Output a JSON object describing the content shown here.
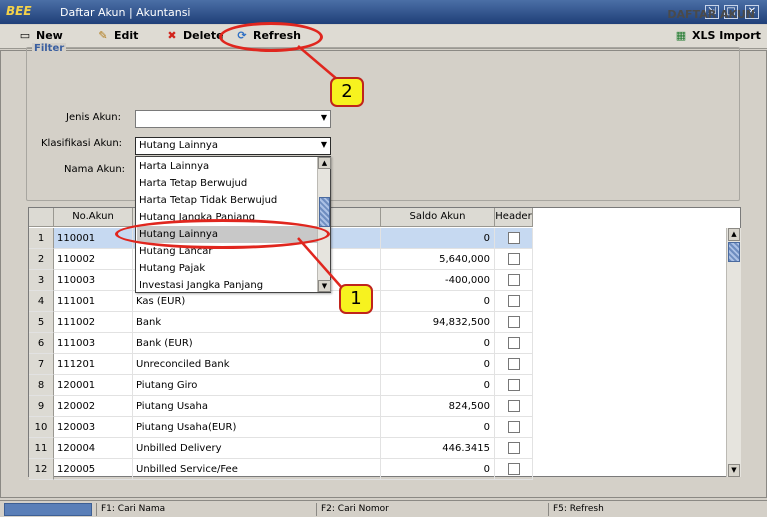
{
  "window": {
    "logo": "BEE",
    "title": "Daftar Akun | Akuntansi",
    "controls": [
      "restore-icon",
      "maximize-icon",
      "close-icon"
    ]
  },
  "toolbar": {
    "new_label": "New",
    "edit_label": "Edit",
    "delete_label": "Delete",
    "refresh_label": "Refresh",
    "xls_label": "XLS Import"
  },
  "section_title": "DAFTAR AKUN",
  "filter": {
    "legend": "Filter",
    "jenis_label": "Jenis Akun:",
    "jenis_value": "",
    "klasifikasi_label": "Klasifikasi Akun:",
    "klasifikasi_value": "Hutang Lainnya",
    "nama_label": "Nama Akun:",
    "dropdown_options": [
      "Harta Lainnya",
      "Harta Tetap Berwujud",
      "Harta Tetap Tidak Berwujud",
      "Hutang Jangka Panjang",
      "Hutang Lainnya",
      "Hutang Lancar",
      "Hutang Pajak",
      "Investasi Jangka Panjang"
    ],
    "dropdown_highlighted": "Hutang Lainnya"
  },
  "table": {
    "columns": [
      "No.Akun",
      "Saldo Akun",
      "Header"
    ],
    "rows": [
      {
        "n": "1",
        "no": "110001",
        "name": "",
        "saldo": "0"
      },
      {
        "n": "2",
        "no": "110002",
        "name": "",
        "saldo": "5,640,000"
      },
      {
        "n": "3",
        "no": "110003",
        "name": "",
        "saldo": "-400,000"
      },
      {
        "n": "4",
        "no": "111001",
        "name": "Kas (EUR)",
        "saldo": "0"
      },
      {
        "n": "5",
        "no": "111002",
        "name": "Bank",
        "saldo": "94,832,500"
      },
      {
        "n": "6",
        "no": "111003",
        "name": "Bank (EUR)",
        "saldo": "0"
      },
      {
        "n": "7",
        "no": "111201",
        "name": "Unreconciled Bank",
        "saldo": "0"
      },
      {
        "n": "8",
        "no": "120001",
        "name": "Piutang Giro",
        "saldo": "0"
      },
      {
        "n": "9",
        "no": "120002",
        "name": "Piutang Usaha",
        "saldo": "824,500"
      },
      {
        "n": "10",
        "no": "120003",
        "name": "Piutang Usaha(EUR)",
        "saldo": "0"
      },
      {
        "n": "11",
        "no": "120004",
        "name": "Unbilled Delivery",
        "saldo": "446.3415"
      },
      {
        "n": "12",
        "no": "120005",
        "name": "Unbilled Service/Fee",
        "saldo": "0"
      }
    ]
  },
  "annotations": {
    "callout_1": "1",
    "callout_2": "2",
    "color": "#e0261e",
    "callout_fill": "#f7f21f"
  },
  "statusbar": {
    "f1": "F1: Cari Nama",
    "f2": "F2: Cari Nomor",
    "f5": "F5: Refresh"
  }
}
